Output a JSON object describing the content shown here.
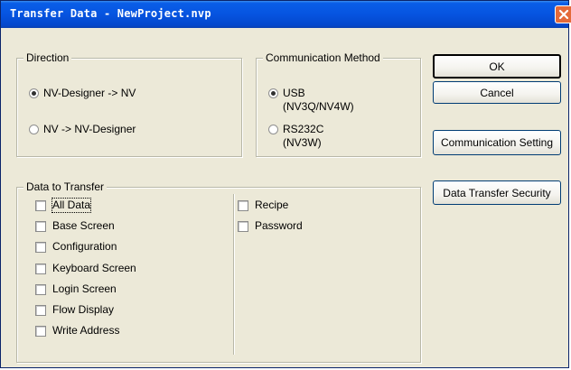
{
  "window": {
    "title": "Transfer Data - NewProject.nvp"
  },
  "direction": {
    "title": "Direction",
    "options": [
      "NV-Designer -> NV",
      "NV -> NV-Designer"
    ],
    "selected_index": 0
  },
  "communication": {
    "title": "Communication Method",
    "options": [
      {
        "line1": "USB",
        "line2": "(NV3Q/NV4W)"
      },
      {
        "line1": "RS232C",
        "line2": "(NV3W)"
      }
    ],
    "selected_index": 0
  },
  "data_to_transfer": {
    "title": "Data to Transfer",
    "left_items": [
      "All Data",
      "Base Screen",
      "Configuration",
      "Keyboard Screen",
      "Login Screen",
      "Flow Display",
      "Write Address"
    ],
    "right_items": [
      "Recipe",
      "Password"
    ]
  },
  "buttons": {
    "ok": "OK",
    "cancel": "Cancel",
    "communication_setting": "Communication Setting",
    "data_transfer_security": "Data Transfer Security"
  },
  "icons": {
    "close": "close-icon"
  },
  "colors": {
    "title_bar": "#0654e0",
    "close_button": "#e46a3a",
    "dialog_background": "#ece9d8"
  }
}
